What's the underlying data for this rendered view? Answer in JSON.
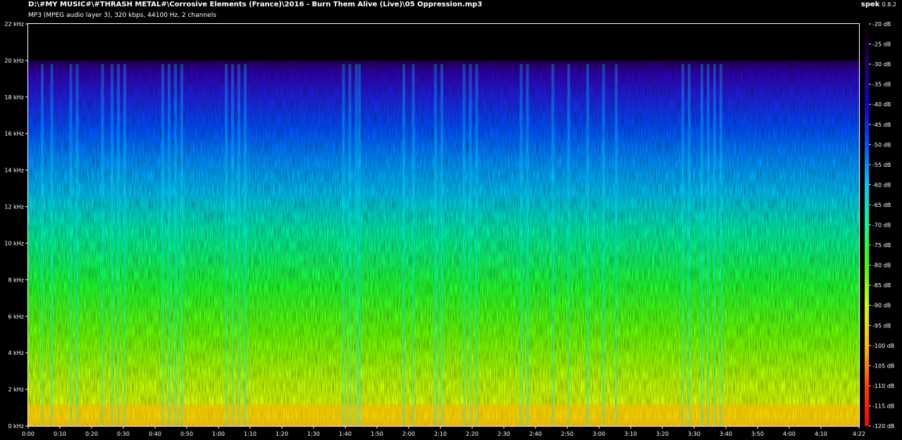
{
  "header": {
    "file_path": "D:\\#MY MUSIC#\\#THRASH METAL#\\Corrosive Elements (France)\\2016 - Burn Them Alive (Live)\\05 Oppression.mp3",
    "stream_info": "MP3 (MPEG audio layer 3), 320 kbps, 44100 Hz, 2 channels",
    "app_name": "spek",
    "app_version": "0.8.2"
  },
  "colors": {
    "background": "#000000",
    "axis": "#ffffff",
    "palette": [
      "#000000",
      "#24005e",
      "#1a00c8",
      "#0050ff",
      "#00c8ff",
      "#00ff90",
      "#40ff00",
      "#d0ff00",
      "#ffc000",
      "#ff4000",
      "#ff0000"
    ]
  },
  "chart_data": {
    "type": "heatmap",
    "title": "",
    "xlabel": "",
    "ylabel": "",
    "x_ticks": [
      "0:00",
      "0:10",
      "0:20",
      "0:30",
      "0:40",
      "0:50",
      "1:00",
      "1:10",
      "1:20",
      "1:30",
      "1:40",
      "1:50",
      "2:00",
      "2:10",
      "2:20",
      "2:30",
      "2:40",
      "2:50",
      "3:00",
      "3:10",
      "3:20",
      "3:30",
      "3:40",
      "3:50",
      "4:00",
      "4:10",
      "4:22"
    ],
    "x_tick_seconds": [
      0,
      10,
      20,
      30,
      40,
      50,
      60,
      70,
      80,
      90,
      100,
      110,
      120,
      130,
      140,
      150,
      160,
      170,
      180,
      190,
      200,
      210,
      220,
      230,
      240,
      250,
      262
    ],
    "y_ticks": [
      "0 kHz",
      "2 kHz",
      "4 kHz",
      "6 kHz",
      "8 kHz",
      "10 kHz",
      "12 kHz",
      "14 kHz",
      "16 kHz",
      "18 kHz",
      "20 kHz",
      "22 kHz"
    ],
    "y_tick_khz": [
      0,
      2,
      4,
      6,
      8,
      10,
      12,
      14,
      16,
      18,
      20,
      22
    ],
    "xlim_seconds": [
      0,
      262
    ],
    "ylim_khz": [
      0,
      22
    ],
    "colorbar_ticks": [
      "-20 dB",
      "-25 dB",
      "-30 dB",
      "-35 dB",
      "-40 dB",
      "-45 dB",
      "-50 dB",
      "-55 dB",
      "-60 dB",
      "-65 dB",
      "-70 dB",
      "-75 dB",
      "-80 dB",
      "-85 dB",
      "-90 dB",
      "-95 dB",
      "-100 dB",
      "-105 dB",
      "-110 dB",
      "-115 dB",
      "-120 dB"
    ],
    "colorbar_db": [
      -20,
      -25,
      -30,
      -35,
      -40,
      -45,
      -50,
      -55,
      -60,
      -65,
      -70,
      -75,
      -80,
      -85,
      -90,
      -95,
      -100,
      -105,
      -110,
      -115,
      -120
    ],
    "lowpass_cutoff_khz": 20,
    "grid": false
  }
}
